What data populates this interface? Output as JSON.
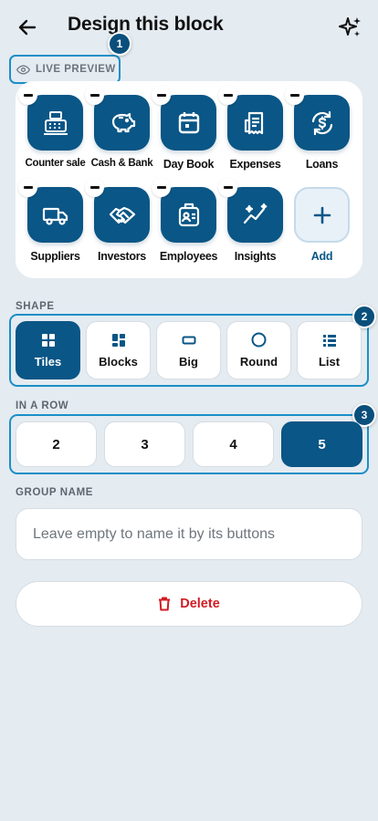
{
  "header": {
    "title": "Design this block"
  },
  "preview": {
    "label": "LIVE PREVIEW",
    "badge": "1",
    "tiles": [
      {
        "label": "Counter sale",
        "icon": "cash-register-icon"
      },
      {
        "label": "Cash & Bank",
        "icon": "piggy-bank-icon"
      },
      {
        "label": "Day Book",
        "icon": "calendar-icon"
      },
      {
        "label": "Expenses",
        "icon": "receipt-icon"
      },
      {
        "label": "Loans",
        "icon": "dollar-sync-icon"
      },
      {
        "label": "Suppliers",
        "icon": "truck-icon"
      },
      {
        "label": "Investors",
        "icon": "handshake-icon"
      },
      {
        "label": "Employees",
        "icon": "id-badge-icon"
      },
      {
        "label": "Insights",
        "icon": "sparkline-icon"
      }
    ],
    "add_label": "Add"
  },
  "shape": {
    "label": "SHAPE",
    "badge": "2",
    "selected": "Tiles",
    "options": [
      {
        "label": "Tiles",
        "icon": "tiles-icon"
      },
      {
        "label": "Blocks",
        "icon": "blocks-icon"
      },
      {
        "label": "Big",
        "icon": "big-icon"
      },
      {
        "label": "Round",
        "icon": "circle-icon"
      },
      {
        "label": "List",
        "icon": "list-icon"
      }
    ]
  },
  "in_a_row": {
    "label": "IN A ROW",
    "badge": "3",
    "selected": "5",
    "options": [
      "2",
      "3",
      "4",
      "5"
    ]
  },
  "group_name": {
    "label": "GROUP NAME",
    "value": "",
    "placeholder": "Leave empty to name it by its buttons"
  },
  "delete": {
    "label": "Delete"
  },
  "colors": {
    "primary": "#0a5686",
    "highlight": "#1a8fc6",
    "danger": "#d11c24",
    "background": "#e4ebf1"
  }
}
